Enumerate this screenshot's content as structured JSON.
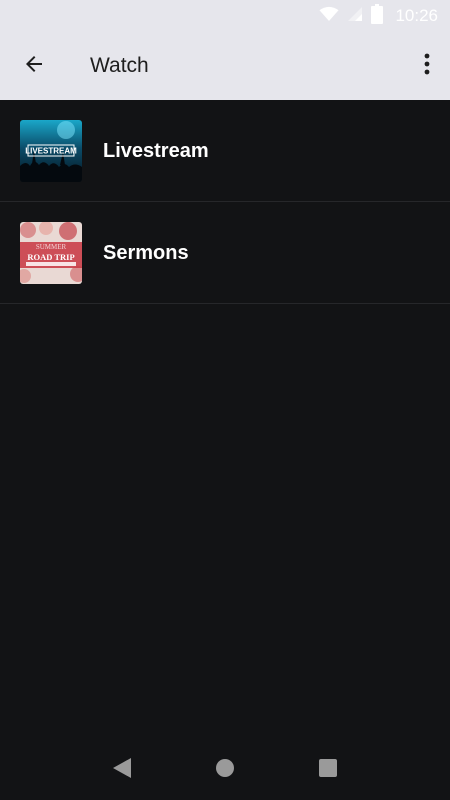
{
  "status_bar": {
    "time": "10:26",
    "icons": [
      "wifi-icon",
      "cell-signal-icon",
      "battery-icon"
    ]
  },
  "app_bar": {
    "title": "Watch",
    "back_icon": "arrow-back-icon",
    "menu_icon": "more-vert-icon"
  },
  "list": {
    "items": [
      {
        "label": "Livestream",
        "thumb_icon": "livestream-thumbnail",
        "thumb_text": "LIVESTREAM"
      },
      {
        "label": "Sermons",
        "thumb_icon": "sermon-series-thumbnail",
        "thumb_text": "ROAD TRIP"
      }
    ]
  },
  "nav_bar": {
    "icons": [
      "nav-back-icon",
      "nav-home-icon",
      "nav-recents-icon"
    ]
  },
  "colors": {
    "background": "#121315",
    "app_bar": "#e6e6ec",
    "divider": "#26272a",
    "text_primary": "#ffffff",
    "title_text": "#1e1e1e"
  }
}
